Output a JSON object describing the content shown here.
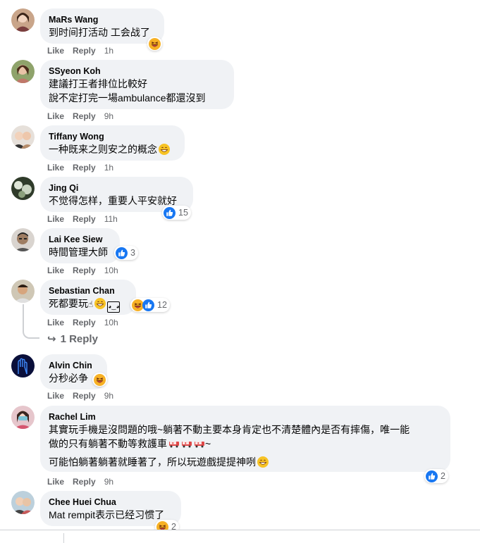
{
  "action_labels": {
    "like": "Like",
    "reply": "Reply"
  },
  "comments": [
    {
      "author": "MaRs Wang",
      "lines": "到时间打活动 工会战了",
      "time": "1h"
    },
    {
      "author": "SSyeon Koh",
      "lines": "建議打王者排位比較好\n說不定打完一場ambulance都還沒到",
      "time": "9h"
    },
    {
      "author": "Tiffany Wong",
      "lines": "一种既来之则安之的概念",
      "time": "1h"
    },
    {
      "author": "Jing Qi",
      "lines": "不觉得怎样，重要人平安就好",
      "time": "11h",
      "reactions": "15"
    },
    {
      "author": "Lai Kee Siew",
      "lines": "時間管理大師",
      "time": "10h",
      "reactions": "3"
    },
    {
      "author": "Sebastian Chan",
      "lines": "死都要玩",
      "time": "10h",
      "reactions": "12"
    },
    {
      "author": "Alvin Chin",
      "lines": "分秒必争",
      "time": "9h"
    },
    {
      "author": "Rachel Lim",
      "lines": "其實玩手機是沒問題的哦~躺著不動主要本身肯定也不清楚體內是否有摔傷，唯一能\n做的只有躺著不動等救護車",
      "line_tail": "~",
      "lines2": "可能怕躺著躺著就睡著了，所以玩遊戲提提神咧",
      "time": "9h",
      "reactions": "2"
    },
    {
      "author": "Chee Huei Chua",
      "lines": "Mat rempit表示已经习惯了",
      "time": "",
      "reactions": "2"
    }
  ],
  "replies_link": "1 Reply",
  "colors": {
    "bubble": "#f0f2f5",
    "secondary_text": "#65676b",
    "like_blue": "#1877f2",
    "haha_yellow": "#f7b125"
  }
}
